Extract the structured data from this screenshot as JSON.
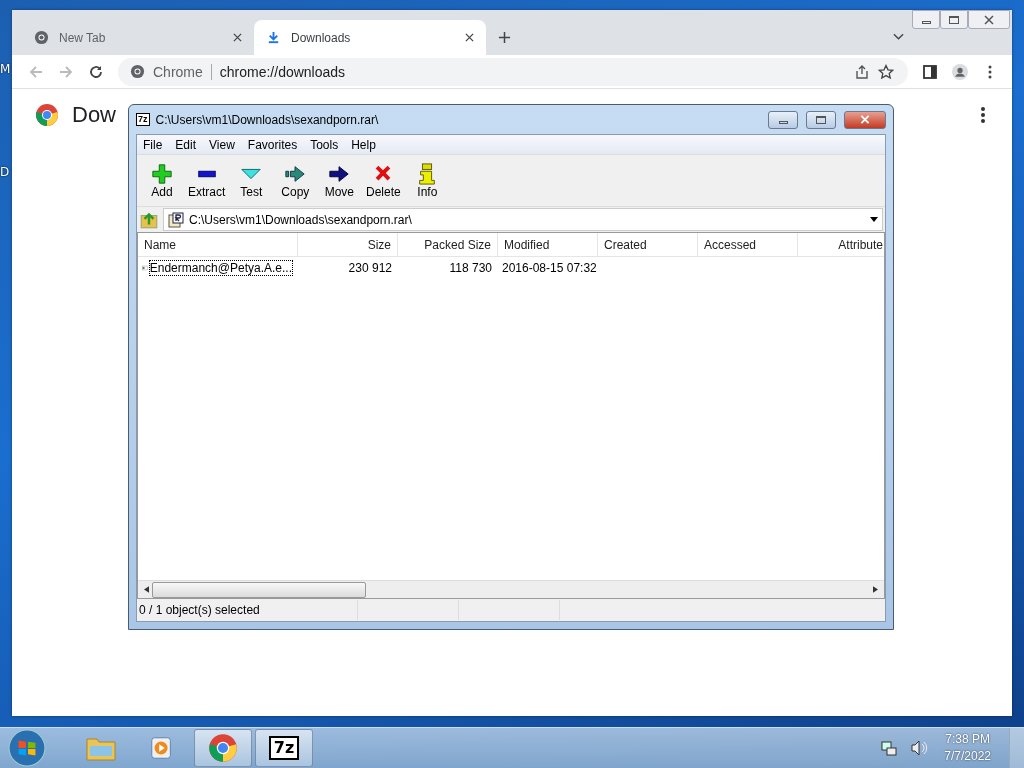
{
  "desktop_labels": [
    "M",
    "D"
  ],
  "browser": {
    "tabs": [
      {
        "label": "New Tab",
        "selected": false,
        "kind": "chrome"
      },
      {
        "label": "Downloads",
        "selected": true,
        "kind": "download"
      }
    ],
    "omnibox": {
      "chip": "Chrome",
      "url": "chrome://downloads"
    },
    "page_title": "Dow"
  },
  "archiver": {
    "title": "C:\\Users\\vm1\\Downloads\\sexandporn.rar\\",
    "logo": "7z",
    "menu": [
      "File",
      "Edit",
      "View",
      "Favorites",
      "Tools",
      "Help"
    ],
    "toolbar": [
      {
        "label": "Add",
        "kind": "add"
      },
      {
        "label": "Extract",
        "kind": "extract"
      },
      {
        "label": "Test",
        "kind": "test"
      },
      {
        "label": "Copy",
        "kind": "copy"
      },
      {
        "label": "Move",
        "kind": "move"
      },
      {
        "label": "Delete",
        "kind": "delete"
      },
      {
        "label": "Info",
        "kind": "info"
      }
    ],
    "path": "C:\\Users\\vm1\\Downloads\\sexandporn.rar\\",
    "columns": [
      "Name",
      "Size",
      "Packed Size",
      "Modified",
      "Created",
      "Accessed",
      "Attribute"
    ],
    "rows": [
      {
        "cells": [
          "Endermanch@Petya.A.e...",
          "230 912",
          "118 730",
          "2016-08-15 07:32",
          "",
          "",
          ""
        ],
        "selected": false,
        "focused": true
      }
    ],
    "status": "0 / 1 object(s) selected"
  },
  "taskbar": {
    "apps": [
      {
        "kind": "explorer",
        "active": false
      },
      {
        "kind": "media",
        "active": false
      },
      {
        "kind": "chrome",
        "active": true
      },
      {
        "kind": "sevenzip",
        "active": true,
        "label": "7z"
      }
    ],
    "time": "7:38 PM",
    "date": "7/7/2022"
  }
}
